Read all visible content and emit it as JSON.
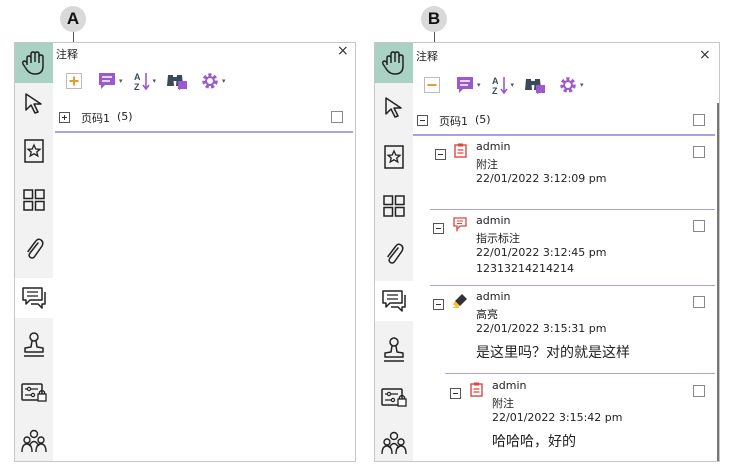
{
  "callouts": {
    "a": "A",
    "b": "B"
  },
  "panel": {
    "title": "注释",
    "close": "×",
    "toolbar_caret": "▾"
  },
  "group": {
    "label": "页码1",
    "count": "(5)"
  },
  "comments": [
    {
      "author": "admin",
      "type": "附注",
      "time": "22/01/2022 3:12:09 pm",
      "body": "",
      "icon": "note-icon",
      "icon_color": "#e0463c"
    },
    {
      "author": "admin",
      "type": "指示标注",
      "time": "22/01/2022 3:12:45 pm",
      "body": "12313214214214",
      "icon": "callout-icon",
      "icon_color": "#e0463c"
    },
    {
      "author": "admin",
      "type": "高亮",
      "time": "22/01/2022 3:15:31 pm",
      "body": "是这里吗？对的就是这样",
      "icon": "highlight-icon",
      "icon_color": "#f4c430"
    },
    {
      "author": "admin",
      "type": "附注",
      "time": "22/01/2022 3:15:42 pm",
      "body": "哈哈哈，好的",
      "icon": "note-icon",
      "icon_color": "#e0463c"
    }
  ],
  "colors": {
    "accent": "#9b59d0",
    "active_tool": "#a9d2c4",
    "separator": "#aaa2e0"
  }
}
